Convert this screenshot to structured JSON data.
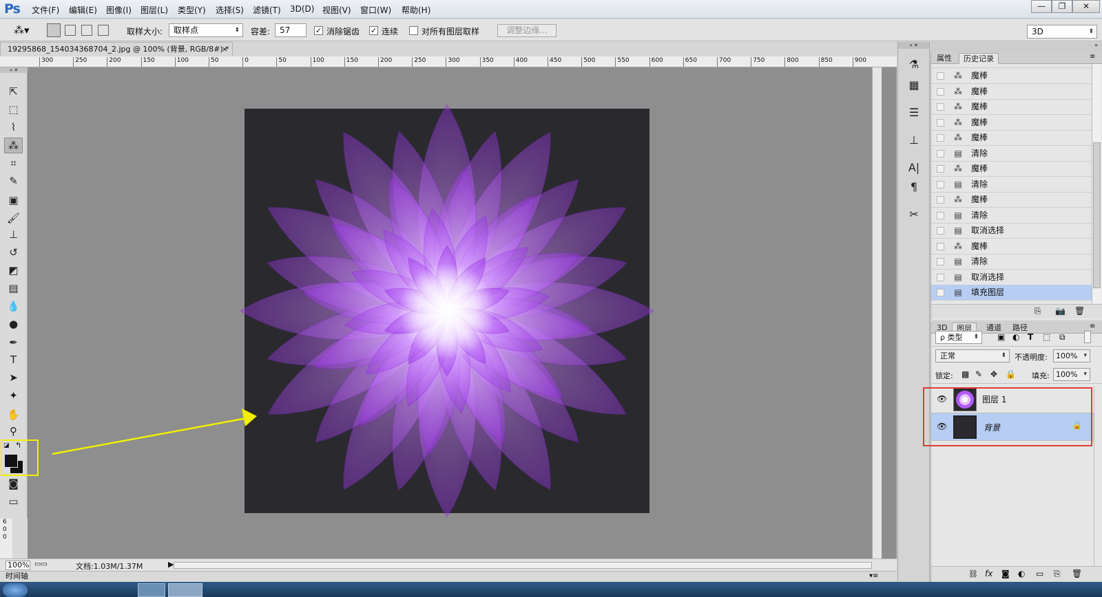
{
  "app": {
    "logo": "Ps"
  },
  "menu": [
    "文件(F)",
    "编辑(E)",
    "图像(I)",
    "图层(L)",
    "类型(Y)",
    "选择(S)",
    "滤镜(T)",
    "3D(D)",
    "视图(V)",
    "窗口(W)",
    "帮助(H)"
  ],
  "window_controls": {
    "min": "—",
    "restore": "❐",
    "close": "✕"
  },
  "options": {
    "sample_size_label": "取样大小:",
    "sample_size_value": "取样点",
    "tolerance_label": "容差:",
    "tolerance_value": "57",
    "antialias_label": "消除锯齿",
    "antialias_checked": true,
    "contiguous_label": "连续",
    "contiguous_checked": true,
    "all_layers_label": "对所有图层取样",
    "all_layers_checked": false,
    "refine_edge_label": "调整边缘...",
    "workspace_value": "3D"
  },
  "document": {
    "tab_title": "19295868_154034368704_2.jpg @ 100% (背景, RGB/8#) *",
    "tab_close": "×",
    "ruler_labels": [
      "0",
      "300",
      "250",
      "200",
      "150",
      "100",
      "50",
      "0",
      "50",
      "100",
      "150",
      "200",
      "250",
      "300",
      "350",
      "400",
      "450",
      "500",
      "550",
      "600",
      "650",
      "700",
      "750",
      "800",
      "850",
      "900"
    ],
    "vertical_ruler_labels": [
      "6",
      "0",
      "0"
    ]
  },
  "status": {
    "zoom": "100%",
    "doc_info": "文档:1.03M/1.37M",
    "timeline_label": "时间轴"
  },
  "history_panel": {
    "tabs": [
      "属性",
      "历史记录"
    ],
    "active_tab": "历史记录",
    "items": [
      {
        "icon": "magic-wand",
        "label": "魔棒"
      },
      {
        "icon": "magic-wand",
        "label": "魔棒"
      },
      {
        "icon": "magic-wand",
        "label": "魔棒"
      },
      {
        "icon": "magic-wand",
        "label": "魔棒"
      },
      {
        "icon": "magic-wand",
        "label": "魔棒"
      },
      {
        "icon": "document",
        "label": "清除"
      },
      {
        "icon": "magic-wand",
        "label": "魔棒"
      },
      {
        "icon": "document",
        "label": "清除"
      },
      {
        "icon": "magic-wand",
        "label": "魔棒"
      },
      {
        "icon": "document",
        "label": "清除"
      },
      {
        "icon": "document",
        "label": "取消选择"
      },
      {
        "icon": "magic-wand",
        "label": "魔棒"
      },
      {
        "icon": "document",
        "label": "清除"
      },
      {
        "icon": "document",
        "label": "取消选择"
      },
      {
        "icon": "document",
        "label": "填充图层"
      }
    ],
    "selected_index": 14
  },
  "layers_panel": {
    "tabs": [
      "3D",
      "图层",
      "通道",
      "路径"
    ],
    "active_tab": "图层",
    "filter_label": "ρ 类型",
    "blend_mode": "正常",
    "opacity_label": "不透明度:",
    "opacity_value": "100%",
    "lock_label": "锁定:",
    "fill_label": "填充:",
    "fill_value": "100%",
    "layers": [
      {
        "name": "图层 1",
        "visible": true,
        "selected": false,
        "locked": false
      },
      {
        "name": "背景",
        "visible": true,
        "selected": true,
        "locked": true
      }
    ]
  },
  "colors": {
    "canvas_bg": "#2a2a2e",
    "workspace": "#8e8e8e",
    "petal_purple": "#a040f0",
    "selection_blue": "#b7cdf2",
    "annotation_red": "#e23a3a",
    "annotation_yellow": "#f0f000"
  }
}
